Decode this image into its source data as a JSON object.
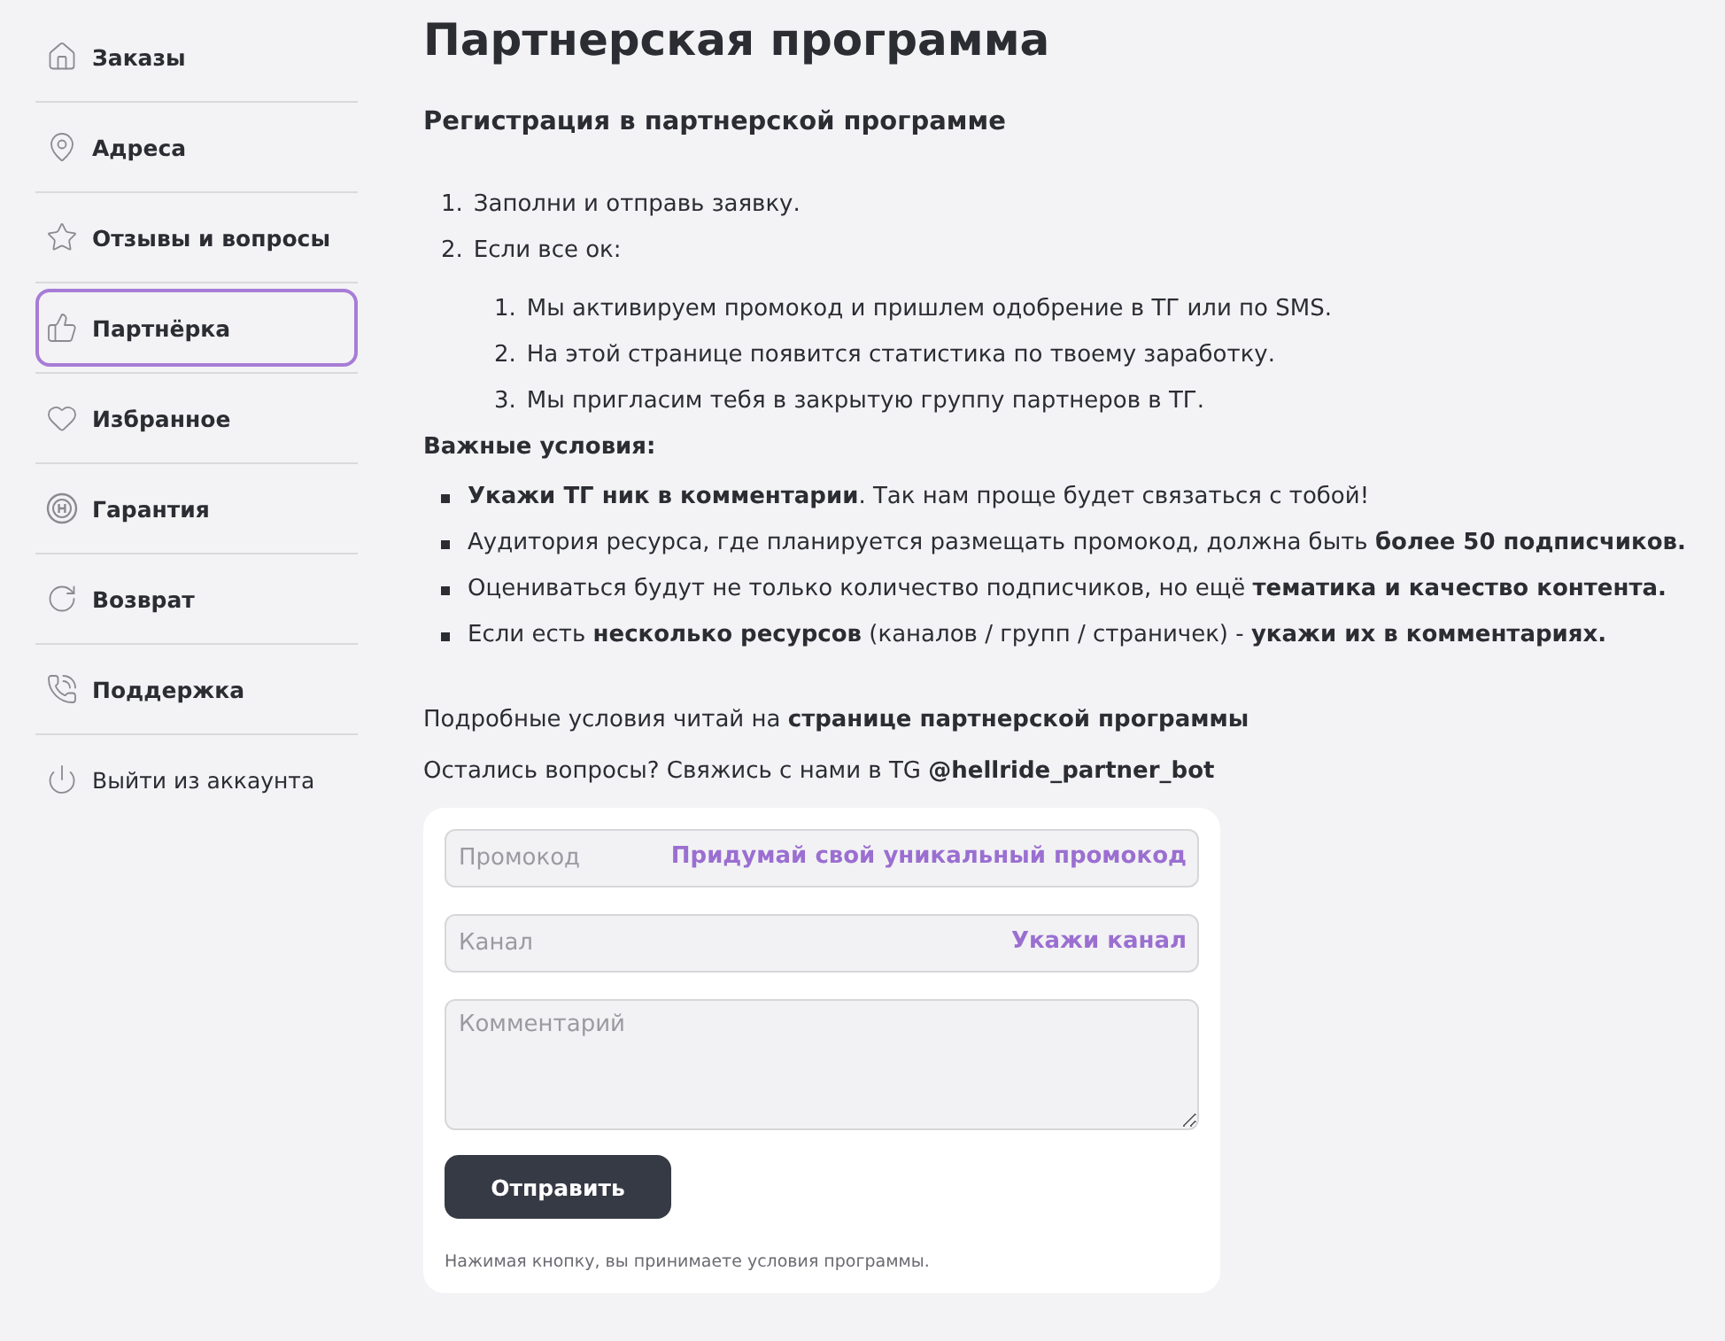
{
  "sidebar": {
    "items": [
      {
        "label": "Заказы",
        "kind": "link",
        "selected": false
      },
      {
        "label": "Адреса",
        "kind": "link",
        "selected": false
      },
      {
        "label": "Отзывы и вопросы",
        "kind": "link",
        "selected": false
      },
      {
        "label": "Партнёрка",
        "kind": "link",
        "selected": true
      },
      {
        "label": "Избранное",
        "kind": "link",
        "selected": false
      },
      {
        "label": "Гарантия",
        "kind": "link",
        "selected": false
      },
      {
        "label": "Возврат",
        "kind": "link",
        "selected": false
      },
      {
        "label": "Поддержка",
        "kind": "link",
        "selected": false
      },
      {
        "label": "Выйти из аккаунта",
        "kind": "logout",
        "selected": false
      }
    ]
  },
  "page": {
    "title": "Партнерская программа",
    "subtitle": "Регистрация в партнерской программе",
    "steps": [
      {
        "marker": "1.",
        "text": "Заполни и отправь заявку."
      },
      {
        "marker": "2.",
        "text": "Если все ок:",
        "children": [
          {
            "marker": "1.",
            "text": "Мы активируем промокод и пришлем одобрение в ТГ или по SMS."
          },
          {
            "marker": "2.",
            "text": "На этой странице появится статистика по твоему заработку."
          },
          {
            "marker": "3.",
            "text": "Мы пригласим тебя в закрытую группу партнеров в ТГ."
          }
        ]
      }
    ],
    "conditions_title": "Важные условия:",
    "conditions": [
      "**Укажи ТГ ник в комментарии**. Так нам проще будет связаться с тобой!",
      "Аудитория ресурса, где планируется размещать промокод, должна быть **более 50 подписчиков.**",
      "Оцениваться будут не только количество подписчиков, но ещё **тематика и качество контента.**",
      "Если есть **несколько ресурсов** (каналов / групп / страничек) - **укажи их в комментариях.**"
    ],
    "notes": [
      "Подробные условия читай на **странице партнерской программы**",
      "Остались вопросы? Свяжись с нами в TG **@hellride_partner_bot**"
    ]
  },
  "form": {
    "fields": [
      {
        "kind": "input",
        "placeholder": "Промокод",
        "hint": "Придумай свой уникальный промокод"
      },
      {
        "kind": "input",
        "placeholder": "Канал",
        "hint": "Укажи канал"
      },
      {
        "kind": "textarea",
        "placeholder": "Комментарий"
      }
    ],
    "submit": "Отправить",
    "disclaimer": "Нажимая кнопку, вы принимаете условия программы."
  }
}
